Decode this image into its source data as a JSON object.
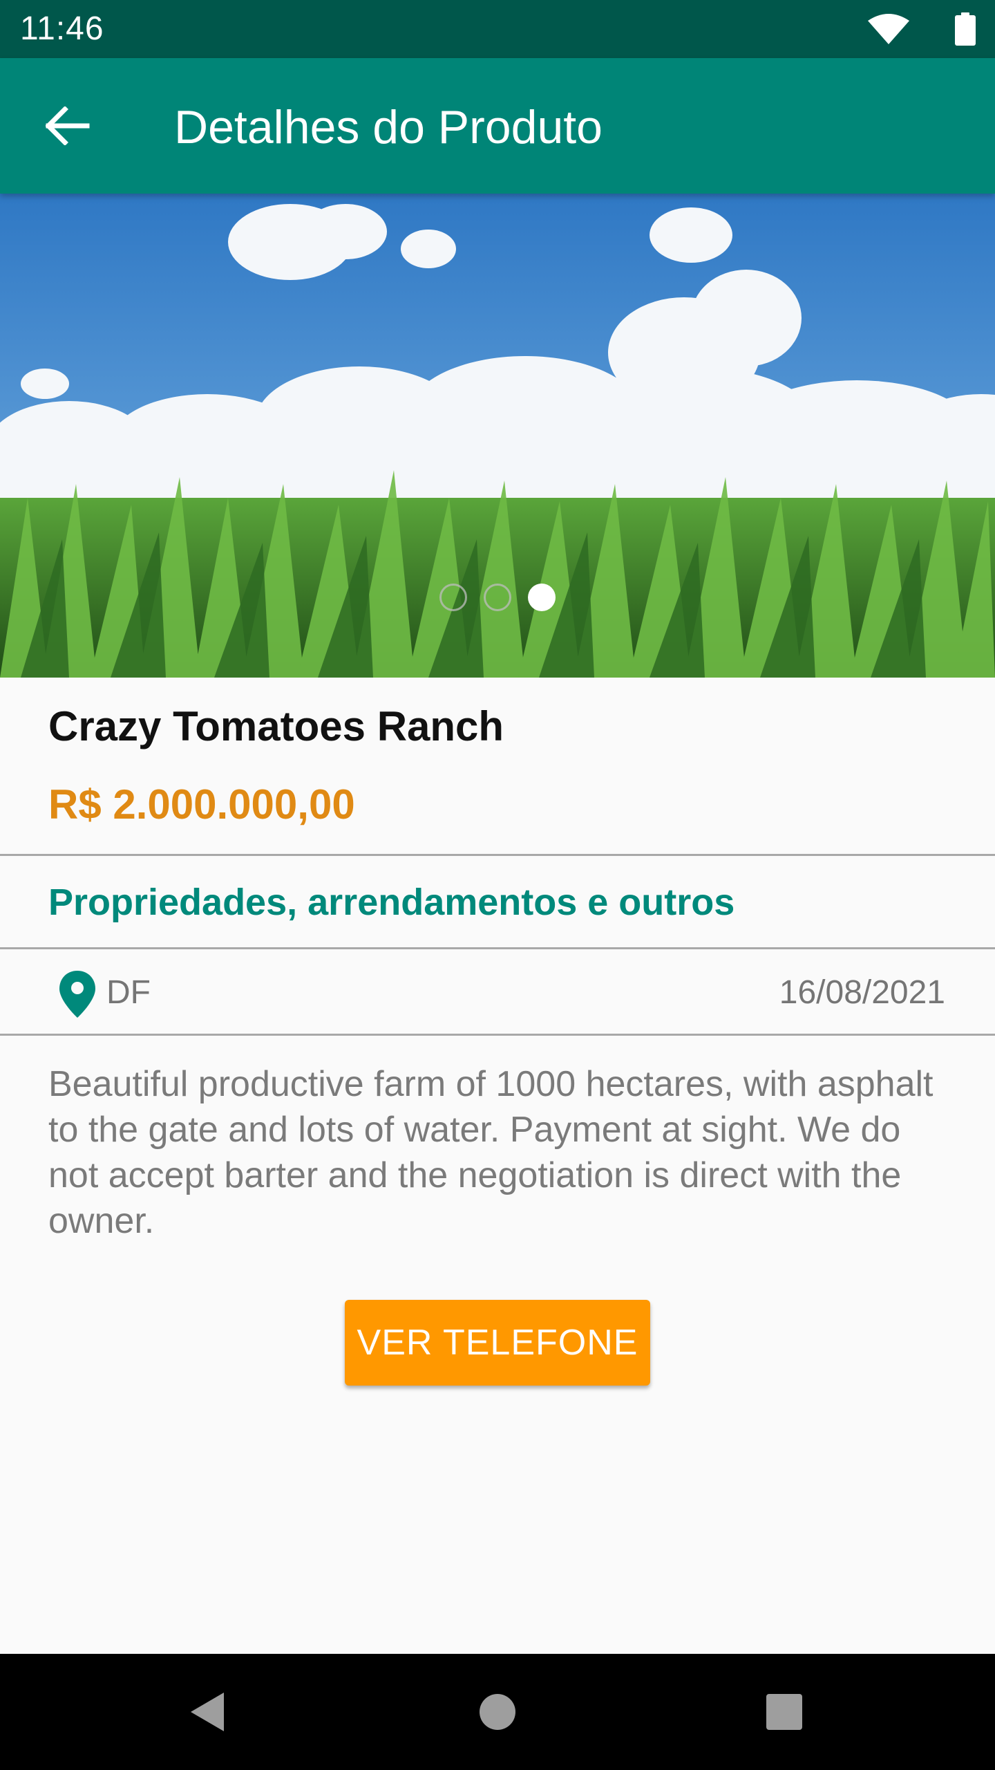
{
  "status_bar": {
    "time": "11:46",
    "icons": [
      "wifi-icon",
      "battery-icon"
    ]
  },
  "app_bar": {
    "title": "Detalhes do Produto",
    "back_icon": "arrow-back-icon"
  },
  "carousel": {
    "page_count": 3,
    "current_page": 3
  },
  "product": {
    "title": "Crazy Tomatoes Ranch",
    "price": "R$ 2.000.000,00",
    "category": "Propriedades, arrendamentos e outros",
    "location": "DF",
    "date": "16/08/2021",
    "description": "Beautiful productive farm of 1000 hectares, with asphalt to the gate and lots of water. Payment at sight. We do not accept barter and the negotiation is direct with the owner.",
    "phone_button_label": "VER TELEFONE"
  },
  "colors": {
    "status_bar": "#00574b",
    "app_bar": "#008577",
    "price": "#e08a14",
    "category": "#00897b",
    "button": "#ff9800"
  },
  "nav_bar": {
    "icons": [
      "back-triangle-icon",
      "home-circle-icon",
      "recents-square-icon"
    ]
  }
}
